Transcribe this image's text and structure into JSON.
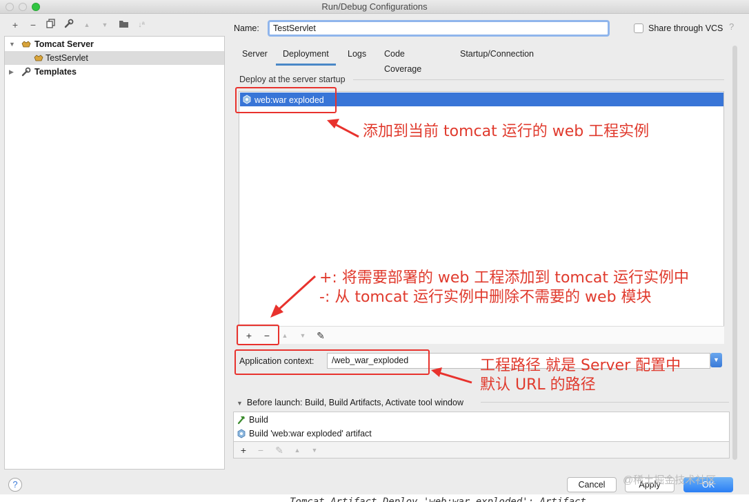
{
  "window": {
    "title": "Run/Debug Configurations"
  },
  "left_toolbar": {
    "icons": [
      "add-icon",
      "remove-icon",
      "copy-icon",
      "wrench-icon",
      "move-up-icon",
      "move-down-icon",
      "folder-icon",
      "sort-icon"
    ]
  },
  "tree": {
    "items": [
      {
        "label": "Tomcat Server",
        "expanded": true,
        "icon": "tomcat-icon"
      },
      {
        "label": "TestServlet",
        "selected": true,
        "icon": "tomcat-icon"
      },
      {
        "label": "Templates",
        "expanded": false,
        "icon": "wrench-icon"
      }
    ]
  },
  "form": {
    "name_label": "Name:",
    "name_value": "TestServlet",
    "share_label": "Share through VCS",
    "share_checked": false,
    "help_glyph": "?"
  },
  "tabs": [
    "Server",
    "Deployment",
    "Logs",
    "Code Coverage",
    "Startup/Connection"
  ],
  "active_tab": "Deployment",
  "deployment": {
    "section_title": "Deploy at the server startup",
    "artifacts": [
      "web:war exploded"
    ],
    "tools": {
      "add": "+",
      "remove": "−",
      "up": "▲",
      "down": "▼",
      "edit": "✎"
    }
  },
  "app_context": {
    "label": "Application context:",
    "value": "/web_war_exploded"
  },
  "before_launch": {
    "title": "Before launch: Build, Build Artifacts, Activate tool window",
    "items": [
      "Build",
      "Build 'web:war exploded' artifact"
    ],
    "tools": {
      "add": "+",
      "remove": "−",
      "edit": "✎",
      "up": "▲",
      "down": "▼"
    }
  },
  "buttons": {
    "cancel": "Cancel",
    "apply": "Apply",
    "ok": "OK",
    "help": "?"
  },
  "annotations": {
    "note1": "添加到当前 tomcat 运行的 web 工程实例",
    "note2_line1": "+: 将需要部署的 web 工程添加到 tomcat 运行实例中",
    "note2_line2": "-: 从 tomcat 运行实例中删除不需要的 web 模块",
    "note3_line1": "工程路径 就是 Server 配置中",
    "note3_line2": "默认 URL 的路径",
    "color": "#e8322d"
  },
  "watermark": "@稀土掘金技术社区",
  "background_code": "Tomcat Artifact Deploy 'web:war exploded': Artifact"
}
